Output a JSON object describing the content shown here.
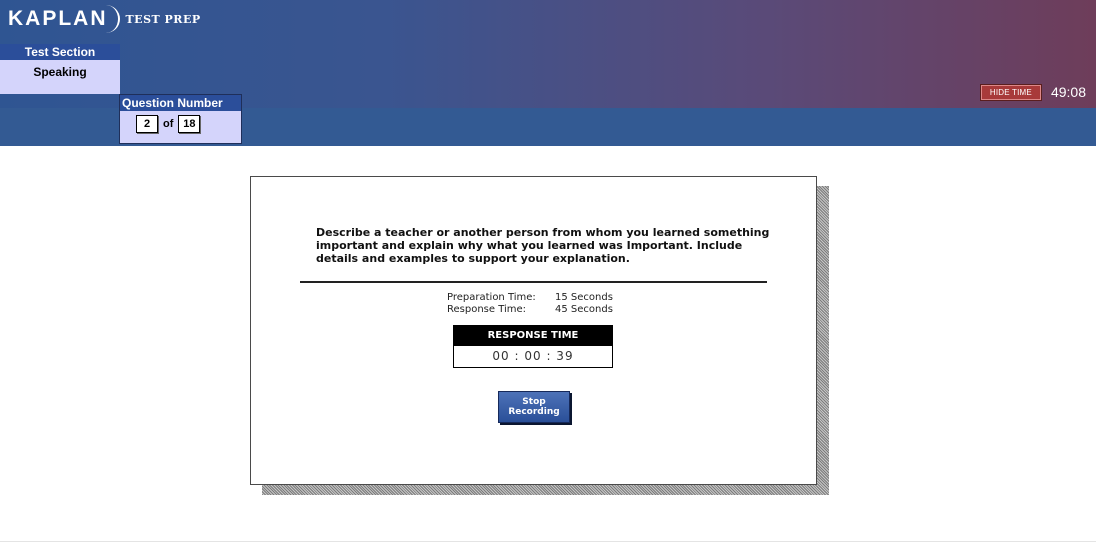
{
  "brand": {
    "logo_word": "KAPLAN",
    "logo_sub": "TEST PREP"
  },
  "test_section": {
    "label": "Test Section",
    "value": "Speaking"
  },
  "question_number": {
    "label": "Question Number",
    "current": "2",
    "of_label": "of",
    "total": "18"
  },
  "timer": {
    "hide_time_label": "HIDE TIME",
    "remaining": "49:08"
  },
  "question": {
    "prompt": "Describe a teacher or another person from whom you learned something important and explain why what you learned was Important. Include details and examples to support your explanation.",
    "preparation_label": "Preparation Time:",
    "preparation_value": "15 Seconds",
    "response_label": "Response Time:",
    "response_value": "45 Seconds"
  },
  "response_time_box": {
    "header": "RESPONSE TIME",
    "value": "00 : 00 : 39"
  },
  "stop_button": {
    "label": "Stop Recording"
  },
  "colors": {
    "header_start": "#2f5592",
    "header_end": "#6e3d5a",
    "band": "#335a93",
    "panel_label": "#2b4e9a",
    "panel_value": "#d4d4fb",
    "hide_time_button": "#a83a3a",
    "stop_button": "#2a4f98"
  }
}
